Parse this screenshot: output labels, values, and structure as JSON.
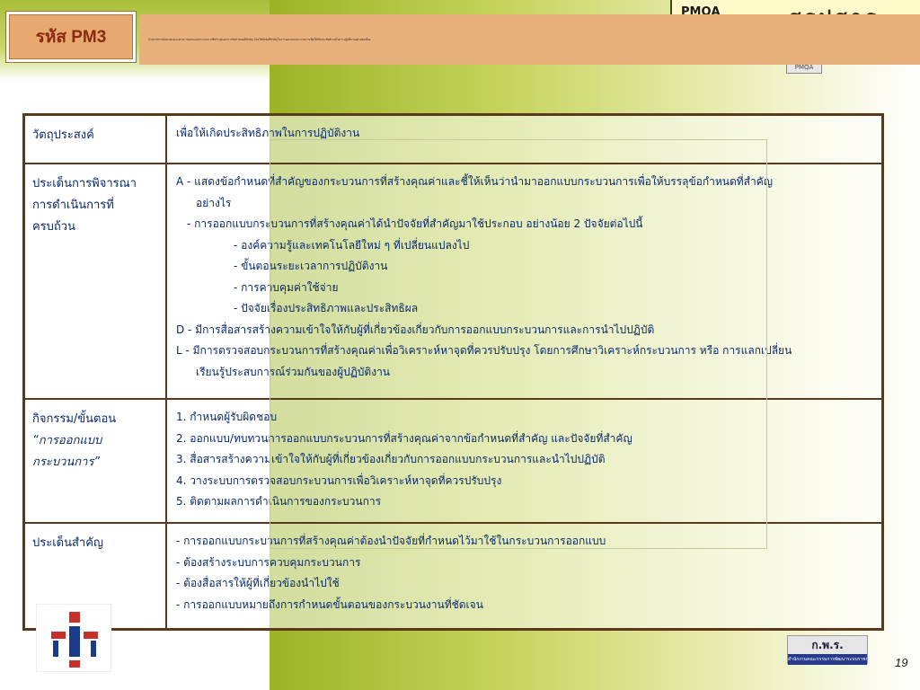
{
  "header": {
    "code": "รหัส PM3",
    "description": "ส่วนราชการต้องแสดงแนวทางการออกแบบกระบวนการที่สร้างคุณค่าจากข้อกำหนดที่สำคัญ โดยใช้ปัจจัยที่สำคัญในการออกแบบกระบวนการเพื่อให้เกิดประสิทธิภาพในการปฏิบัติงานอย่างต่อเนื่อง"
  },
  "top_right": {
    "label": "PMQA",
    "deco": "สรุปสาระ"
  },
  "badge": "PMQA",
  "table": {
    "rows": [
      {
        "header": [
          "วัตถุประสงค์"
        ],
        "lines": [
          "เพื่อให้เกิดประสิทธิภาพในการปฏิบัติงาน"
        ]
      },
      {
        "header": [
          "ประเด็นการพิจารณา",
          "การดำเนินการที่",
          "ครบถ้วน"
        ],
        "lines": [
          "A - แสดงข้อกำหนดที่สำคัญของกระบวนการที่สร้างคุณค่าและชี้ให้เห็นว่านำมาออกแบบกระบวนการเพื่อให้บรรลุข้อกำหนดที่สำคัญ",
          "อย่างไร",
          "- การออกแบบกระบวนการที่สร้างคุณค่าได้นำปัจจัยที่สำคัญมาใช้ประกอบ อย่างน้อย 2 ปัจจัยต่อไปนี้",
          "- องค์ความรู้และเทคโนโลยีใหม่ ๆ ที่เปลี่ยนแปลงไป",
          "- ขั้นตอนระยะเวลาการปฏิบัติงาน",
          "- การควบคุมค่าใช้จ่าย",
          "- ปัจจัยเรื่องประสิทธิภาพและประสิทธิผล",
          "D - มีการสื่อสารสร้างความเข้าใจให้กับผู้ที่เกี่ยวข้องเกี่ยวกับการออกแบบกระบวนการและการนำไปปฏิบัติ",
          "L - มีการตรวจสอบกระบวนการที่สร้างคุณค่าเพื่อวิเคราะห์หาจุดที่ควรปรับปรุง โดยการศึกษาวิเคราะห์กระบวนการ หรือ การแลกเปลี่ยน",
          "เรียนรู้ประสบการณ์ร่วมกันของผู้ปฏิบัติงาน"
        ]
      },
      {
        "header": [
          "กิจกรรม/ขั้นตอน",
          "“การออกแบบ",
          "กระบวนการ”"
        ],
        "lines": [
          "1. กำหนดผู้รับผิดชอบ",
          "2. ออกแบบ/ทบทวนการออกแบบกระบวนการที่สร้างคุณค่าจากข้อกำหนดที่สำคัญ และปัจจัยที่สำคัญ",
          "3. สื่อสารสร้างความเข้าใจให้กับผู้ที่เกี่ยวข้องเกี่ยวกับการออกแบบกระบวนการและนำไปปฏิบัติ",
          "4. วางระบบการตรวจสอบกระบวนการเพื่อวิเคราะห์หาจุดที่ควรปรับปรุง",
          "5. ติดตามผลการดำเนินการของกระบวนการ"
        ]
      },
      {
        "header": [
          "ประเด็นสำคัญ"
        ],
        "lines": [
          "- การออกแบบกระบวนการที่สร้างคุณค่าต้องนำปัจจัยที่กำหนดไว้มาใช้ในกระบวนการออกแบบ",
          "- ต้องสร้างระบบการควบคุมกระบวนการ",
          "- ต้องสื่อสารให้ผู้ที่เกี่ยวข้องนำไปใช้",
          "- การออกแบบหมายถึงการกำหนดขั้นตอนของกระบวนงานที่ชัดเจน"
        ]
      }
    ]
  },
  "footer": {
    "logo_title": "ก.พ.ร.",
    "logo_subtitle": "สำนักงานคณะกรรมการพัฒนาระบบราชการ",
    "page_number": "19"
  },
  "colors": {
    "text": "#0a2a6a",
    "border": "#5a3a1a",
    "header_bar": "#e8b07a",
    "code_box": "#e8a970"
  }
}
